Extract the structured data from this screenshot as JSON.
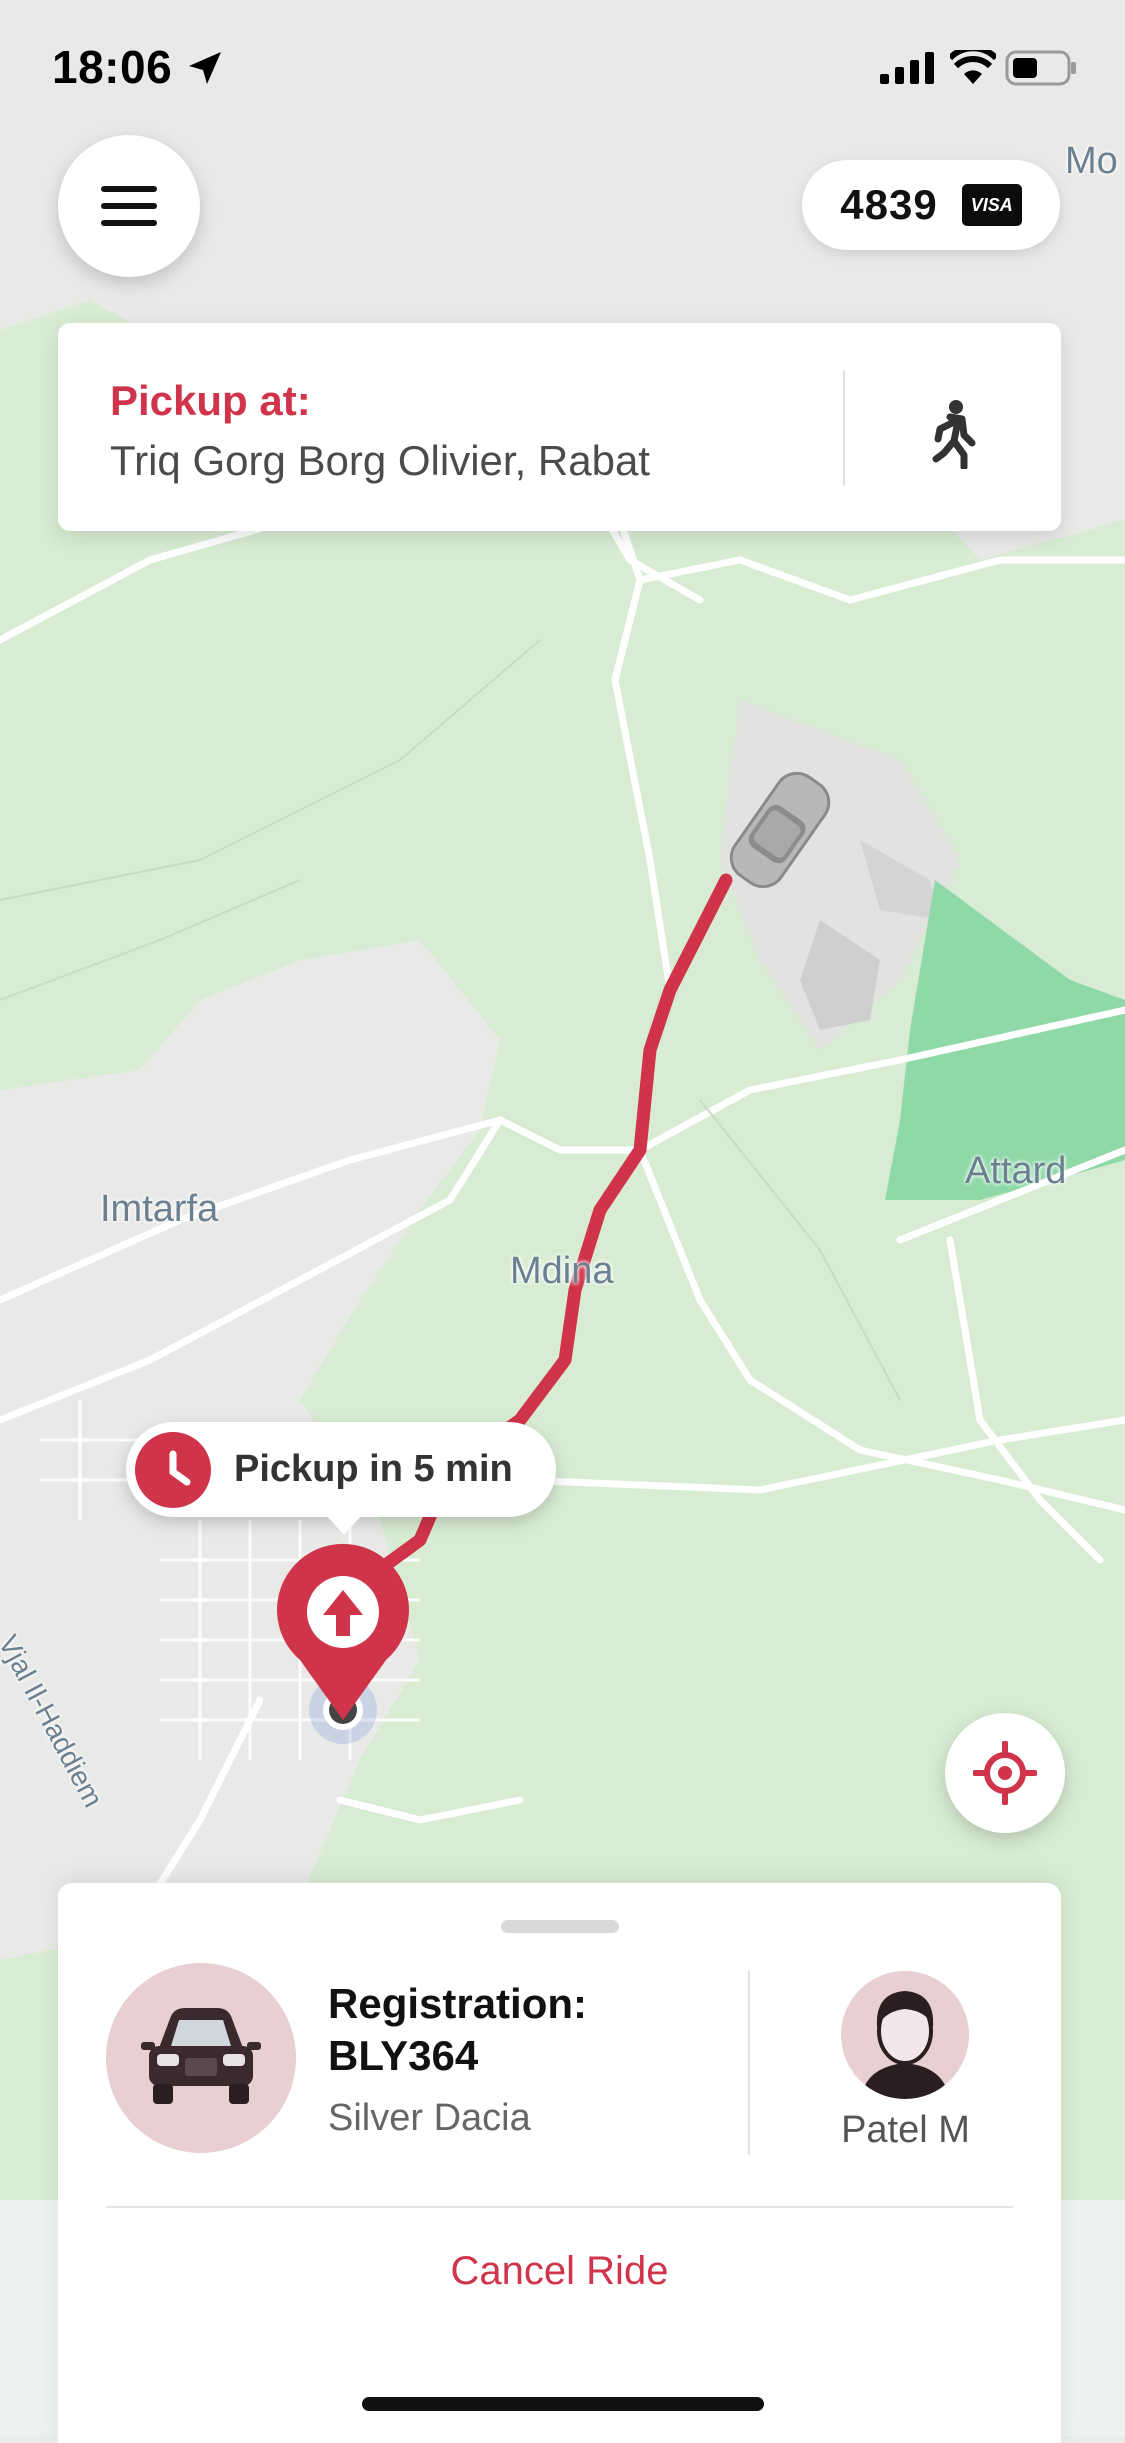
{
  "status_bar": {
    "time": "18:06"
  },
  "header": {
    "card_last4": "4839",
    "card_brand": "VISA"
  },
  "pickup": {
    "title": "Pickup at:",
    "address": "Triq Gorg Borg Olivier, Rabat"
  },
  "map": {
    "labels": {
      "imtarfa": "Imtarfa",
      "mdina": "Mdina",
      "attard": "Attard",
      "road": "Vjal Il-Haddiem",
      "corner": "Mo"
    },
    "route_color": "#d0344b"
  },
  "eta": {
    "text": "Pickup in 5 min"
  },
  "ride": {
    "registration_label": "Registration:",
    "registration": "BLY364",
    "car": "Silver Dacia",
    "driver": "Patel M",
    "cancel": "Cancel Ride"
  },
  "colors": {
    "accent": "#d0344b",
    "park": "#8fd9a8",
    "land": "#d9ecd4"
  }
}
